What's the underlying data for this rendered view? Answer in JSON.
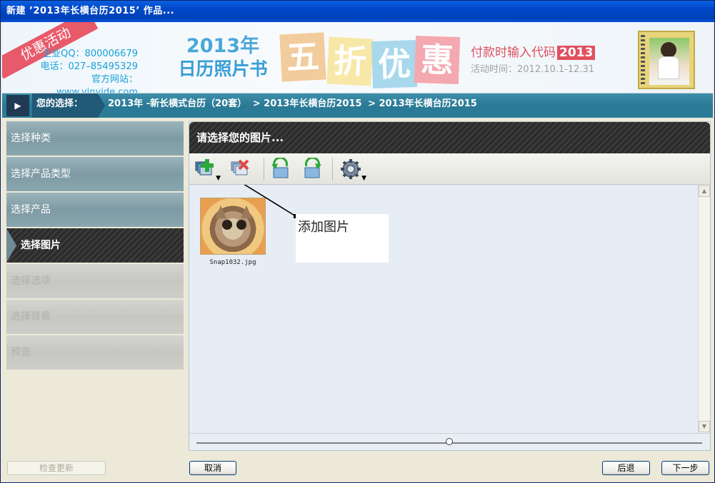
{
  "window": {
    "title": "新建 ’2013年长横台历2015’ 作品..."
  },
  "banner": {
    "ribbon": "优惠活动",
    "contact_qq": "企业QQ：800006679",
    "contact_phone": "电话：027–85495329",
    "contact_site": "官方网站：www.yinyide.com",
    "promo_year": "2013年",
    "promo_sub": "日历照片书",
    "tiles": [
      "五",
      "折",
      "优",
      "惠"
    ],
    "code_label": "付款时输入代码",
    "code_value": "2013",
    "date": "活动时间：2012.10.1-12.31"
  },
  "breadcrumb": {
    "label": "您的选择：",
    "items": [
      "2013年 -新长横式台历（20套）",
      "> 2013年长横台历2015",
      "> 2013年长横台历2015"
    ]
  },
  "sidebar": {
    "items": [
      {
        "label": "选择种类",
        "state": "normal"
      },
      {
        "label": "选择产品类型",
        "state": "normal"
      },
      {
        "label": "选择产品",
        "state": "normal"
      },
      {
        "label": "选择图片",
        "state": "active"
      },
      {
        "label": "选择选项",
        "state": "disabled"
      },
      {
        "label": "选择背景",
        "state": "disabled"
      },
      {
        "label": "预览",
        "state": "disabled"
      }
    ],
    "check_update": "检查更新"
  },
  "panel": {
    "title": "请选择您的图片...",
    "toolbar": [
      "add-image",
      "delete-image",
      "rotate-left",
      "rotate-right",
      "settings"
    ],
    "images": [
      {
        "filename": "Snap1032.jpg"
      }
    ],
    "callout": "添加图片",
    "slider_value": 0.5
  },
  "buttons": {
    "cancel": "取消",
    "back": "后退",
    "next": "下一步"
  },
  "colors": {
    "titlebar": "#0047c8",
    "crumbbar": "#2a7996",
    "sidebar": "#8aa6ae",
    "active": "#2f2f2f"
  }
}
